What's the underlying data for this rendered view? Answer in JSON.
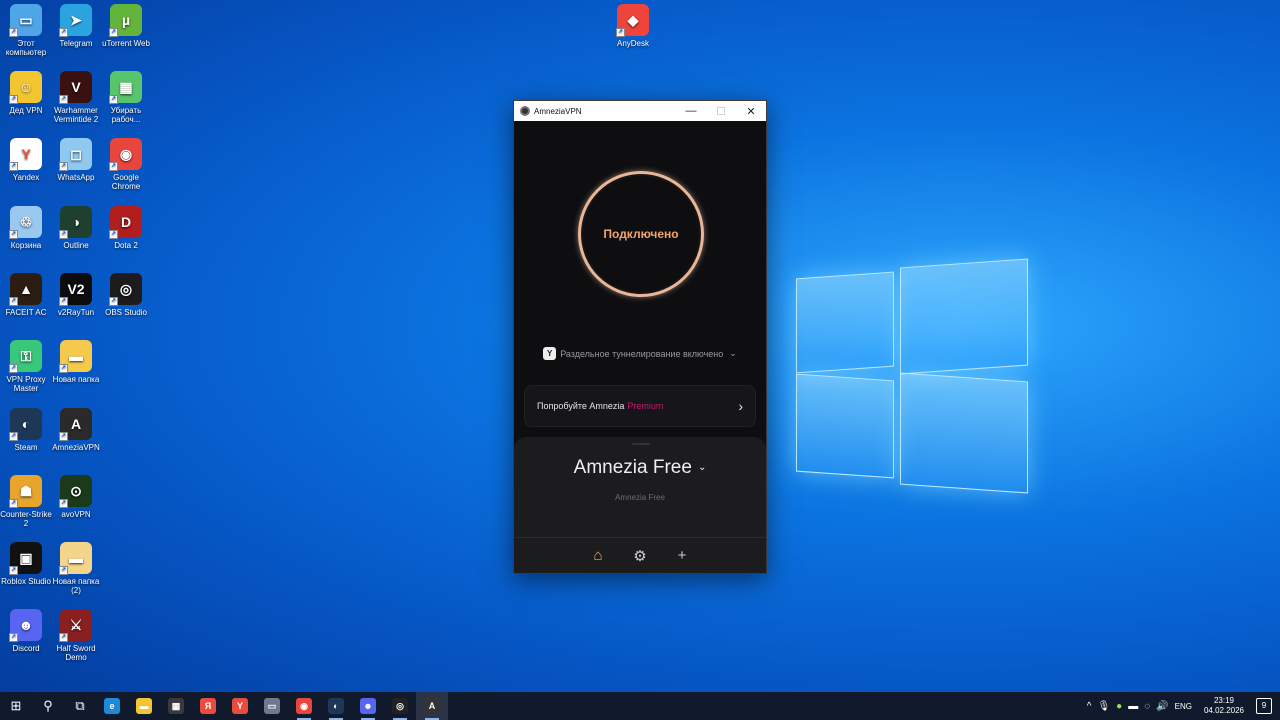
{
  "desktop": {
    "icons": [
      {
        "label": "Этот компьютер",
        "color": "#4ea6e8",
        "glyph": "▭"
      },
      {
        "label": "Telegram",
        "color": "#2aa3e0",
        "glyph": "➤"
      },
      {
        "label": "uTorrent Web",
        "color": "#63b43b",
        "glyph": "µ"
      },
      {
        "label": "AnyDesk",
        "color": "#ef443b",
        "glyph": "◆"
      },
      {
        "label": "Дед VPN",
        "color": "#f2c531",
        "glyph": "☺"
      },
      {
        "label": "Warhammer Vermintide 2",
        "color": "#3a1010",
        "glyph": "V"
      },
      {
        "label": "Убирать рабоч...",
        "color": "#58c46b",
        "glyph": "▦"
      },
      {
        "label": "Yandex",
        "color": "#ffffff",
        "glyph": "Y"
      },
      {
        "label": "WhatsApp",
        "color": "#8fc9f0",
        "glyph": "◻"
      },
      {
        "label": "Google Chrome",
        "color": "#e8453c",
        "glyph": "◉"
      },
      {
        "label": "Корзина",
        "color": "#9bc8ee",
        "glyph": "♲"
      },
      {
        "label": "Outline",
        "color": "#1f3f2f",
        "glyph": "◑"
      },
      {
        "label": "Dota 2",
        "color": "#b11e1e",
        "glyph": "D"
      },
      {
        "label": "FACEIT AC",
        "color": "#2b1d12",
        "glyph": "▲"
      },
      {
        "label": "v2RayTun",
        "color": "#0c0c0c",
        "glyph": "V2"
      },
      {
        "label": "OBS Studio",
        "color": "#1c1c1c",
        "glyph": "◎"
      },
      {
        "label": "VPN Proxy Master",
        "color": "#39c77b",
        "glyph": "⚿"
      },
      {
        "label": "Новая папка",
        "color": "#f4c94c",
        "glyph": "▬"
      },
      {
        "label": "Steam",
        "color": "#1d3757",
        "glyph": "◐"
      },
      {
        "label": "AmneziaVPN",
        "color": "#2a2a2a",
        "glyph": "A"
      },
      {
        "label": "Counter-Strike 2",
        "color": "#e8a52c",
        "glyph": "☗"
      },
      {
        "label": "avoVPN",
        "color": "#1a3a1a",
        "glyph": "⊙"
      },
      {
        "label": "Roblox Studio",
        "color": "#111111",
        "glyph": "▣"
      },
      {
        "label": "Новая папка (2)",
        "color": "#f4d58a",
        "glyph": "▬"
      },
      {
        "label": "Discord",
        "color": "#5865f2",
        "glyph": "☻"
      },
      {
        "label": "Half Sword Demo",
        "color": "#8b1f1f",
        "glyph": "⚔"
      }
    ]
  },
  "window": {
    "title": "AmneziaVPN",
    "minimize": "—",
    "maximize": "☐",
    "close": "✕"
  },
  "app": {
    "connect_status": "Подключено",
    "split_tunnel_icon": "Y",
    "split_tunnel_label": "Раздельное туннелирование включено",
    "split_tunnel_chevron": "⌄",
    "promo_text": "Попробуйте Amnezia",
    "promo_highlight": "Premium",
    "promo_arrow": "›",
    "server_name": "Amnezia Free",
    "server_caret": "⌄",
    "server_sub": "Amnezia Free",
    "nav_home": "⌂",
    "nav_settings": "⚙",
    "nav_add": "+"
  },
  "taskbar": {
    "start": "⊞",
    "search": "⚲",
    "taskview": "⧉",
    "apps": [
      {
        "name": "edge",
        "glyph": "e",
        "color": "#1d8ad8"
      },
      {
        "name": "explorer",
        "glyph": "▬",
        "color": "#f2c531"
      },
      {
        "name": "store",
        "glyph": "▦",
        "color": "#3a3a3a"
      },
      {
        "name": "yandex-browser",
        "glyph": "Я",
        "color": "#e84c3d"
      },
      {
        "name": "yandex",
        "glyph": "Y",
        "color": "#e84c3d"
      },
      {
        "name": "app-gray",
        "glyph": "▭",
        "color": "#6d7a8c"
      },
      {
        "name": "chrome",
        "glyph": "◉",
        "color": "#e8453c"
      },
      {
        "name": "steam",
        "glyph": "◐",
        "color": "#1d3757"
      },
      {
        "name": "discord",
        "glyph": "☻",
        "color": "#5865f2"
      },
      {
        "name": "obs",
        "glyph": "◎",
        "color": "#222"
      },
      {
        "name": "amnezia",
        "glyph": "A",
        "color": "#333"
      }
    ],
    "tray_chevron": "^",
    "language": "ENG",
    "time": "23:19",
    "date": "04.02.2026",
    "notifications": "9"
  }
}
